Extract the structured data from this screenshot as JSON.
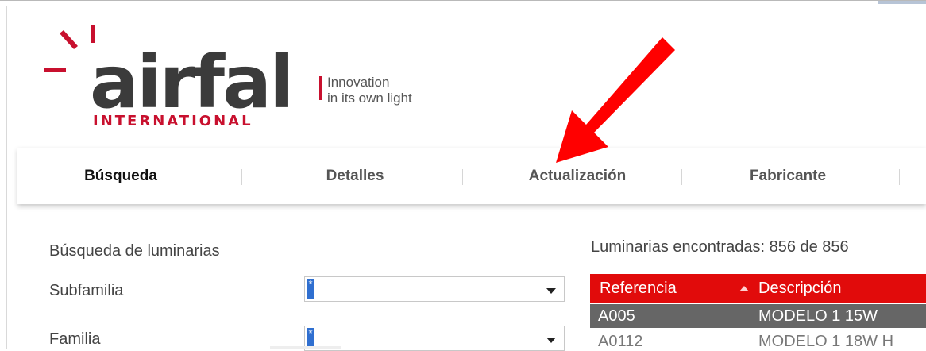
{
  "brand": {
    "name": "airfal",
    "subtitle": "INTERNATIONAL",
    "tagline_line1": "Innovation",
    "tagline_line2": "in its own light",
    "colors": {
      "red": "#c8102e",
      "dark": "#3b3b3b"
    }
  },
  "nav": {
    "tabs": [
      {
        "label": "Búsqueda",
        "active": true
      },
      {
        "label": "Detalles",
        "active": false
      },
      {
        "label": "Actualización",
        "active": false
      },
      {
        "label": "Fabricante",
        "active": false
      }
    ]
  },
  "annotation": {
    "icon": "red-arrow-icon",
    "color": "#ff0000"
  },
  "search": {
    "title": "Búsqueda de luminarias",
    "fields": [
      {
        "label": "Subfamilia",
        "value": "*"
      },
      {
        "label": "Familia",
        "value": "*"
      }
    ]
  },
  "results": {
    "count_text": "Luminarias encontradas: 856 de 856",
    "columns": [
      "Referencia",
      "Descripción"
    ],
    "sort_icon": "sort-ascending-icon",
    "rows": [
      {
        "ref": "A005",
        "desc": "MODELO 1 15W",
        "selected": true
      },
      {
        "ref": "A0112",
        "desc": "MODELO 1 18W H",
        "selected": false
      }
    ],
    "header_color": "#e10b0b"
  }
}
